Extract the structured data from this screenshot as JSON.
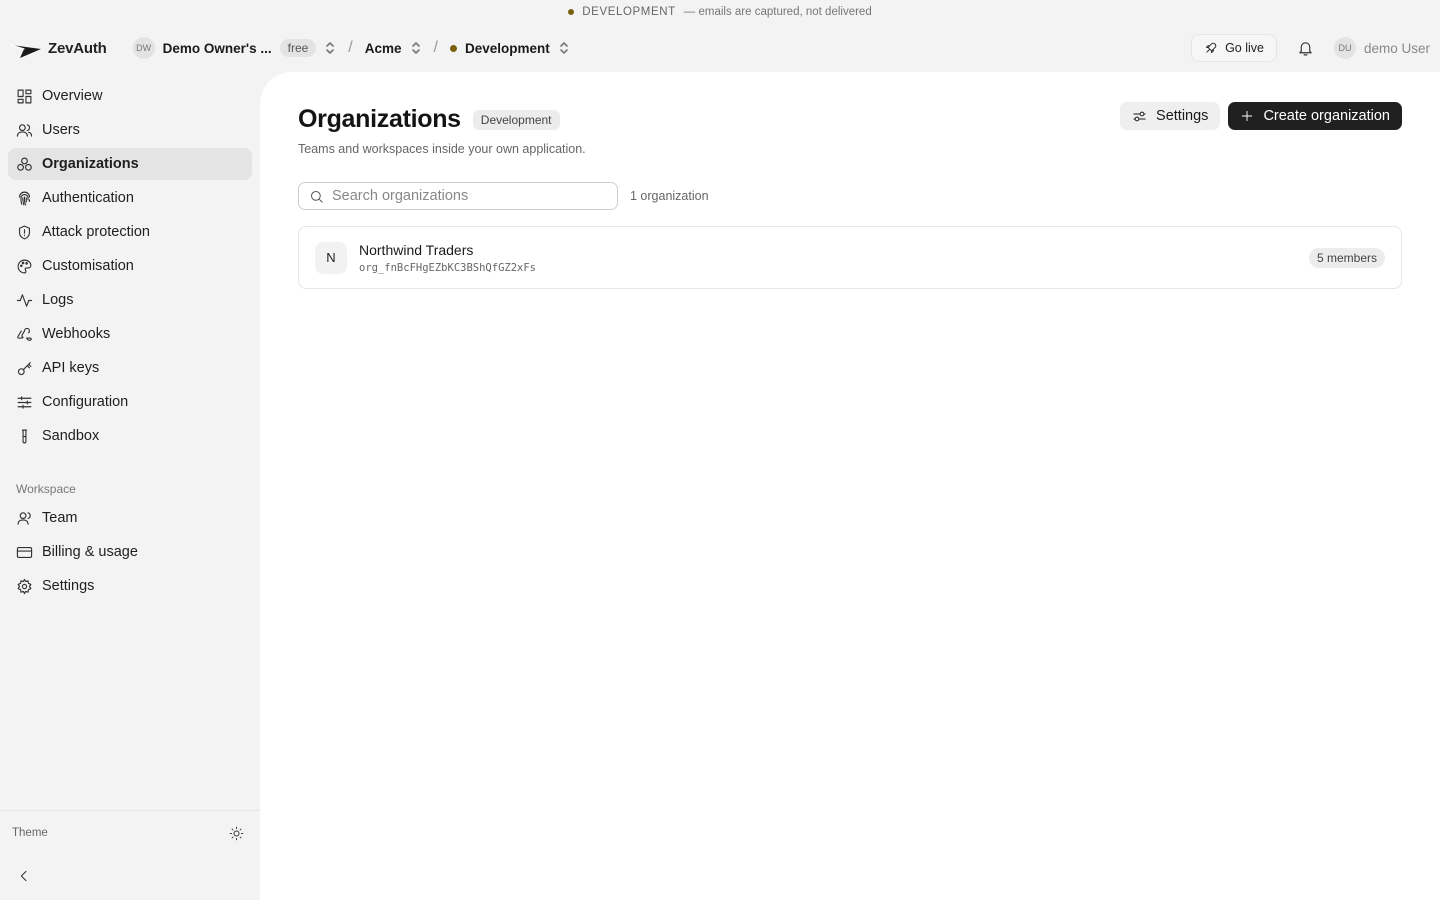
{
  "env_banner": {
    "label": "DEVELOPMENT",
    "note": "— emails are captured, not delivered",
    "dot_color": "#7a5f0c"
  },
  "topbar": {
    "brand": "ZevAuth",
    "workspace": {
      "initials": "DW",
      "name": "Demo Owner's ...",
      "plan": "free"
    },
    "tenant": "Acme",
    "environment": "Development",
    "go_live_label": "Go live",
    "user": {
      "initials": "DU",
      "name": "demo User"
    },
    "icons": [
      "logo-icon",
      "chevron-updown-icon",
      "rocket-icon",
      "bell-icon"
    ]
  },
  "sidebar": {
    "items": [
      {
        "label": "Overview",
        "icon": "grid-icon"
      },
      {
        "label": "Users",
        "icon": "users-icon"
      },
      {
        "label": "Organizations",
        "icon": "organizations-icon",
        "active": true
      },
      {
        "label": "Authentication",
        "icon": "fingerprint-icon"
      },
      {
        "label": "Attack protection",
        "icon": "shield-icon"
      },
      {
        "label": "Customisation",
        "icon": "palette-icon"
      },
      {
        "label": "Logs",
        "icon": "activity-icon"
      },
      {
        "label": "Webhooks",
        "icon": "webhook-icon"
      },
      {
        "label": "API keys",
        "icon": "key-icon"
      },
      {
        "label": "Configuration",
        "icon": "sliders-icon"
      },
      {
        "label": "Sandbox",
        "icon": "test-tube-icon"
      }
    ],
    "workspace_section": {
      "label": "Workspace",
      "items": [
        {
          "label": "Team",
          "icon": "user-icon"
        },
        {
          "label": "Billing & usage",
          "icon": "credit-card-icon"
        },
        {
          "label": "Settings",
          "icon": "gear-icon"
        }
      ]
    },
    "theme_label": "Theme"
  },
  "main": {
    "title": "Organizations",
    "env_badge": "Development",
    "subtitle": "Teams and workspaces inside your own application.",
    "settings_label": "Settings",
    "create_label": "Create organization",
    "search_placeholder": "Search organizations",
    "count": "1 organization",
    "organizations": [
      {
        "initial": "N",
        "name": "Northwind Traders",
        "id": "org_fnBcFHgEZbKC3BShQfGZ2xFs",
        "members": "5 members"
      }
    ]
  }
}
